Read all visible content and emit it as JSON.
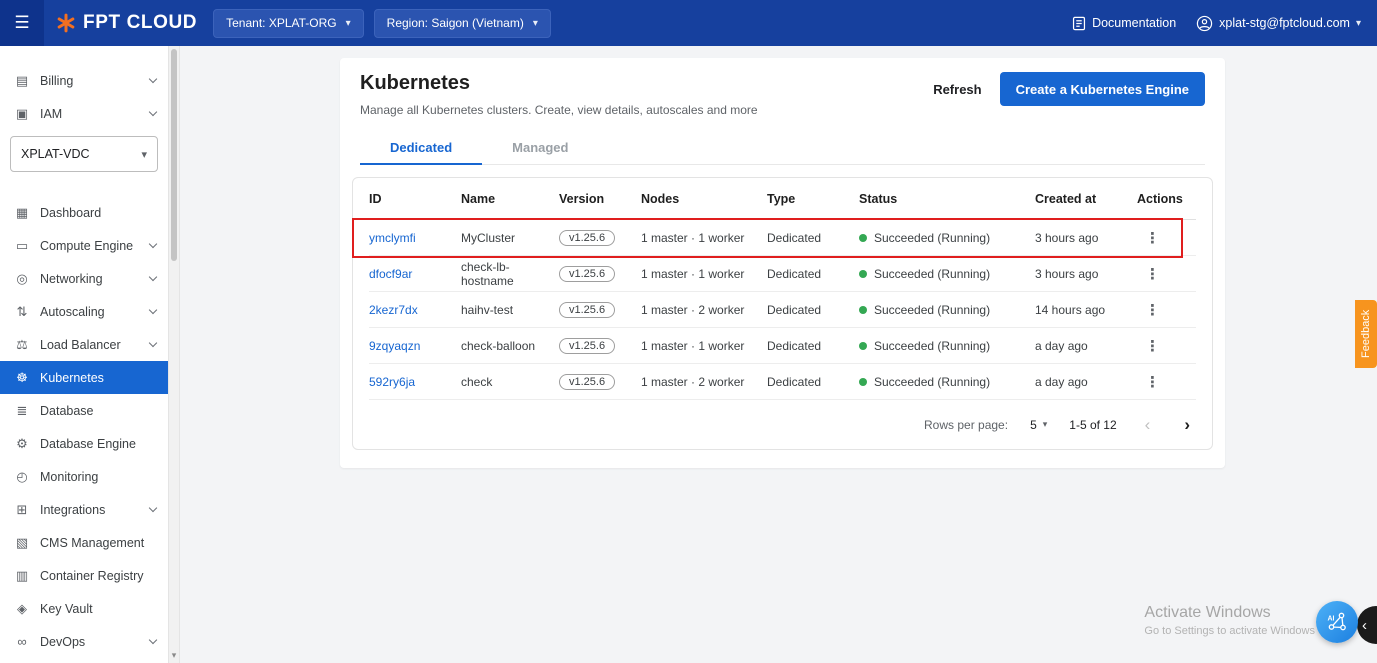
{
  "topbar": {
    "brand": "FPT CLOUD",
    "tenant": "Tenant: XPLAT-ORG",
    "region": "Region: Saigon (Vietnam)",
    "documentation": "Documentation",
    "account": "xplat-stg@fptcloud.com"
  },
  "icons": {
    "hamburger": "☰",
    "caret_down": "▾",
    "kebab": "⋮",
    "prev": "‹",
    "next": "›",
    "scroll_down": "▾"
  },
  "sidebar": {
    "top_items": [
      {
        "label": "Billing",
        "icon": "▤"
      },
      {
        "label": "IAM",
        "icon": "▣"
      }
    ],
    "vdc_selector": "XPLAT-VDC",
    "items": [
      {
        "label": "Dashboard",
        "icon": "▦"
      },
      {
        "label": "Compute Engine",
        "icon": "▭"
      },
      {
        "label": "Networking",
        "icon": "◎"
      },
      {
        "label": "Autoscaling",
        "icon": "⇅"
      },
      {
        "label": "Load Balancer",
        "icon": "⚖"
      },
      {
        "label": "Kubernetes",
        "icon": "☸"
      },
      {
        "label": "Database",
        "icon": "≣"
      },
      {
        "label": "Database Engine",
        "icon": "⚙"
      },
      {
        "label": "Monitoring",
        "icon": "◴"
      },
      {
        "label": "Integrations",
        "icon": "⊞"
      },
      {
        "label": "CMS Management",
        "icon": "▧"
      },
      {
        "label": "Container Registry",
        "icon": "▥"
      },
      {
        "label": "Key Vault",
        "icon": "◈"
      },
      {
        "label": "DevOps",
        "icon": "∞"
      }
    ]
  },
  "page": {
    "title": "Kubernetes",
    "subtitle": "Manage all Kubernetes clusters. Create, view details, autoscales and more",
    "refresh": "Refresh",
    "create_button": "Create a Kubernetes Engine",
    "tab_dedicated": "Dedicated",
    "tab_managed": "Managed"
  },
  "table": {
    "columns": [
      "ID",
      "Name",
      "Version",
      "Nodes",
      "Type",
      "Status",
      "Created at",
      "Actions"
    ],
    "rows": [
      {
        "id": "ymclymfi",
        "name": "MyCluster",
        "version": "v1.25.6",
        "nodes": "1 master · 1 worker",
        "type": "Dedicated",
        "status": "Succeeded (Running)",
        "created": "3 hours ago"
      },
      {
        "id": "dfocf9ar",
        "name": "check-lb-hostname",
        "version": "v1.25.6",
        "nodes": "1 master · 1 worker",
        "type": "Dedicated",
        "status": "Succeeded (Running)",
        "created": "3 hours ago"
      },
      {
        "id": "2kezr7dx",
        "name": "haihv-test",
        "version": "v1.25.6",
        "nodes": "1 master · 2 worker",
        "type": "Dedicated",
        "status": "Succeeded (Running)",
        "created": "14 hours ago"
      },
      {
        "id": "9zqyaqzn",
        "name": "check-balloon",
        "version": "v1.25.6",
        "nodes": "1 master · 1 worker",
        "type": "Dedicated",
        "status": "Succeeded (Running)",
        "created": "a day ago"
      },
      {
        "id": "592ry6ja",
        "name": "check",
        "version": "v1.25.6",
        "nodes": "1 master · 2 worker",
        "type": "Dedicated",
        "status": "Succeeded (Running)",
        "created": "a day ago"
      }
    ],
    "highlighted_row": 0
  },
  "pagination": {
    "label": "Rows per page:",
    "per_page": "5",
    "range": "1-5 of 12"
  },
  "feedback": "Feedback",
  "watermark": {
    "line1": "Activate Windows",
    "line2": "Go to Settings to activate Windows"
  },
  "colors": {
    "topbar_blue": "#16409e",
    "primary_blue": "#1766d1",
    "status_green": "#34a853",
    "annotation_red": "#e01e1e",
    "feedback_orange": "#f7941e"
  }
}
